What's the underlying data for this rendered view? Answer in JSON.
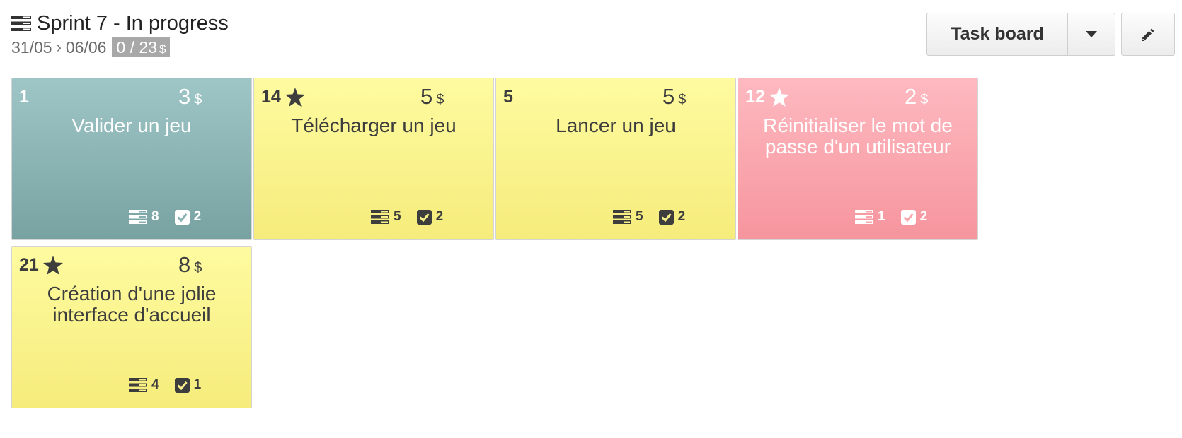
{
  "sprint": {
    "title": "Sprint 7 - In progress",
    "start": "31/05",
    "end": "06/06",
    "progress": "0 / 23",
    "currency": "$"
  },
  "toolbar": {
    "view_label": "Task board"
  },
  "colors": {
    "teal": "#8db5b5",
    "yellow": "#faf38e",
    "pink": "#fba7ae"
  },
  "stories": [
    {
      "id": "1",
      "starred": false,
      "points": "3",
      "currency": "$",
      "name": "Valider un jeu",
      "tasks": "8",
      "acceptance": "2",
      "color": "teal"
    },
    {
      "id": "14",
      "starred": true,
      "points": "5",
      "currency": "$",
      "name": "Télécharger un jeu",
      "tasks": "5",
      "acceptance": "2",
      "color": "yellow"
    },
    {
      "id": "5",
      "starred": false,
      "points": "5",
      "currency": "$",
      "name": "Lancer un jeu",
      "tasks": "5",
      "acceptance": "2",
      "color": "yellow"
    },
    {
      "id": "12",
      "starred": true,
      "points": "2",
      "currency": "$",
      "name": "Réinitialiser le mot de passe d'un utilisateur",
      "tasks": "1",
      "acceptance": "2",
      "color": "pink"
    },
    {
      "id": "21",
      "starred": true,
      "points": "8",
      "currency": "$",
      "name": "Création d'une jolie interface d'accueil",
      "tasks": "4",
      "acceptance": "1",
      "color": "yellow"
    }
  ]
}
